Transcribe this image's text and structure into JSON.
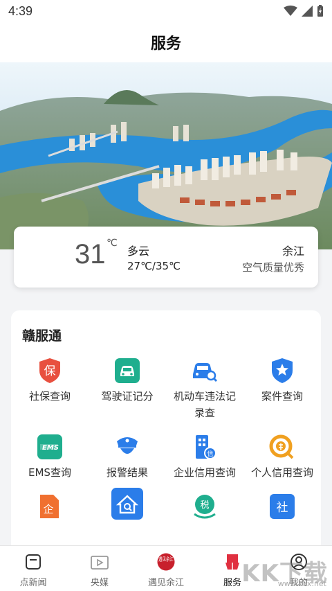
{
  "status_bar": {
    "time": "4:39"
  },
  "header": {
    "title": "服务"
  },
  "weather": {
    "temperature": "31",
    "unit": "℃",
    "condition": "多云",
    "range": "27℃/35℃",
    "city": "余江",
    "air_quality": "空气质量优秀"
  },
  "services": {
    "section_title": "赣服通",
    "items": [
      {
        "label": "社保查询",
        "icon": "insurance-icon",
        "color": "#e8503f"
      },
      {
        "label": "驾驶证记分",
        "icon": "car-icon",
        "color": "#1fae8e"
      },
      {
        "label": "机动车违法记录查",
        "icon": "car-search-icon",
        "color": "#2b7de9"
      },
      {
        "label": "案件查询",
        "icon": "star-shield-icon",
        "color": "#2b7de9"
      },
      {
        "label": "EMS查询",
        "icon": "ems-icon",
        "color": "#1fae8e"
      },
      {
        "label": "报警结果",
        "icon": "police-icon",
        "color": "#2b7de9"
      },
      {
        "label": "企业信用查询",
        "icon": "enterprise-credit-icon",
        "color": "#2b7de9"
      },
      {
        "label": "个人信用查询",
        "icon": "personal-credit-icon",
        "color": "#f0a020"
      },
      {
        "label": "",
        "icon": "enterprise-search-icon",
        "color": "#f07030"
      },
      {
        "label": "",
        "icon": "house-search-icon",
        "color": "#2b7de9"
      },
      {
        "label": "",
        "icon": "tax-icon",
        "color": "#1fae8e"
      },
      {
        "label": "",
        "icon": "social-icon",
        "color": "#2b7de9"
      }
    ],
    "icon_texts": {
      "insurance": "保",
      "ems": "EMS",
      "tax": "税",
      "social": "社",
      "enterprise": "企",
      "credit": "信"
    }
  },
  "tabs": [
    {
      "label": "点新闻",
      "icon": "news-icon",
      "active": false
    },
    {
      "label": "央媒",
      "icon": "video-icon",
      "active": false
    },
    {
      "label": "遇见余江",
      "icon": "yujian-logo-icon",
      "active": false,
      "logo_text": "遇见余江"
    },
    {
      "label": "服务",
      "icon": "service-icon",
      "active": true
    },
    {
      "label": "我的",
      "icon": "user-icon",
      "active": false
    }
  ],
  "watermark": {
    "brand": "KK下载",
    "url": "www.kkx.net"
  },
  "colors": {
    "accent": "#e03040",
    "river": "#2a8fd8",
    "sky": "#bfe0f5"
  }
}
